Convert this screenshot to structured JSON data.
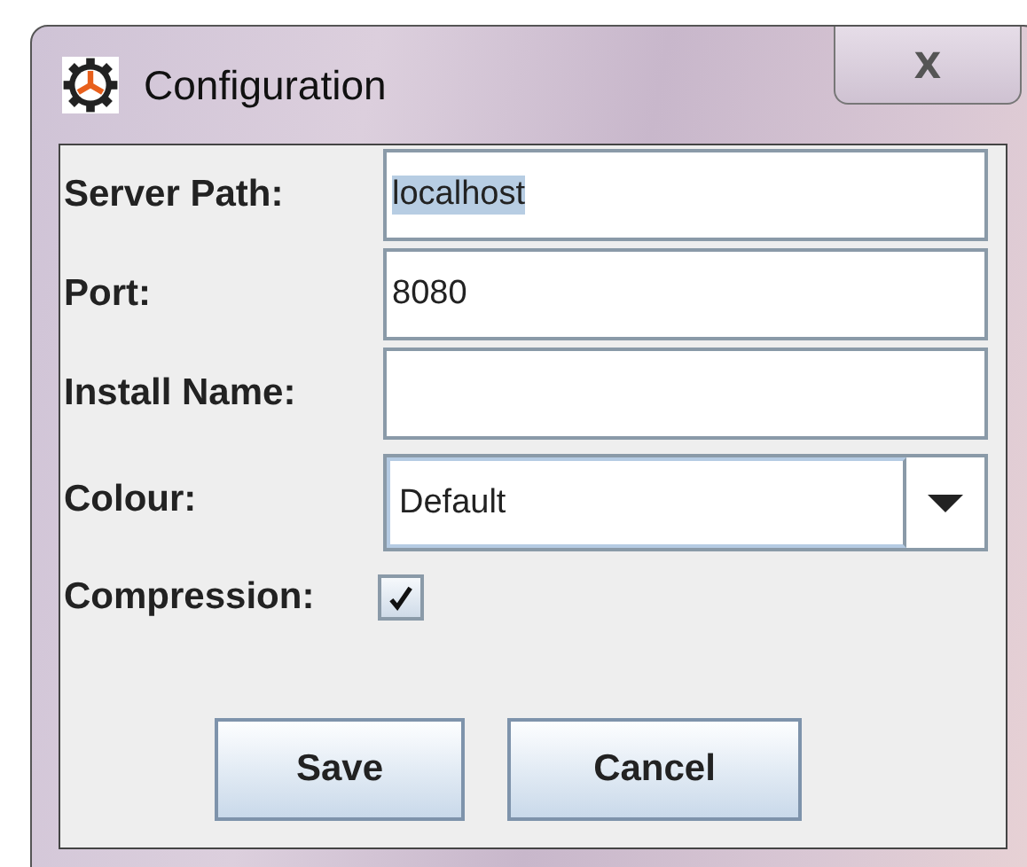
{
  "window": {
    "title": "Configuration",
    "close": "X"
  },
  "fields": [
    {
      "kind": "text",
      "label": "Server Path:",
      "value": "localhost",
      "text_selected": true
    },
    {
      "kind": "text",
      "label": "Port:",
      "value": "8080",
      "text_selected": false
    },
    {
      "kind": "text",
      "label": "Install Name:"
    },
    {
      "kind": "dropdown",
      "label": "Colour:",
      "value": "Default"
    },
    {
      "kind": "checkbox",
      "label": "Compression:",
      "checked": true
    }
  ],
  "buttons": [
    "Save",
    "Cancel"
  ]
}
